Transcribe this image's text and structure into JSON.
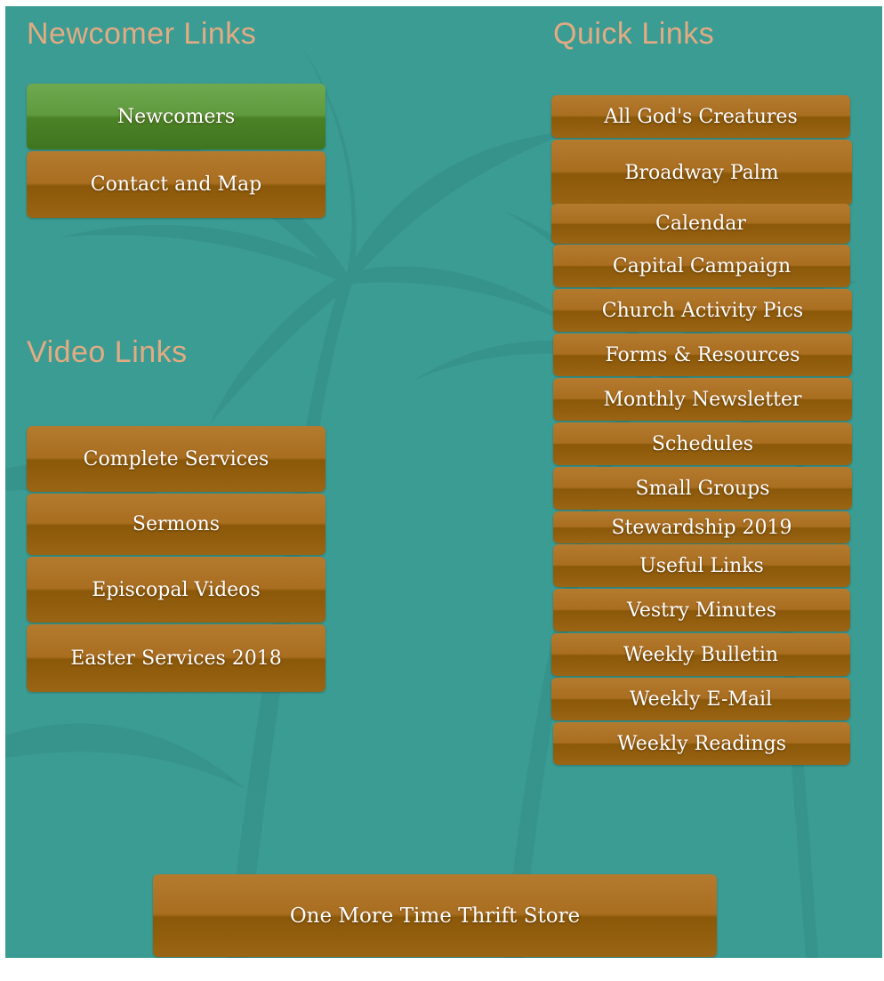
{
  "colors": {
    "background": "#3b9c94",
    "heading": "#e2ab82",
    "button_brown": "#a06a1c",
    "button_green": "#4f8a2c",
    "button_text": "#ffffff"
  },
  "newcomer": {
    "heading": "Newcomer Links",
    "buttons": [
      "Newcomers",
      "Contact and Map"
    ]
  },
  "video": {
    "heading": "Video Links",
    "buttons": [
      "Complete Services",
      "Sermons",
      "Episcopal Videos",
      "Easter Services 2018"
    ]
  },
  "quick": {
    "heading": "Quick Links",
    "buttons": [
      "All God's Creatures",
      "Broadway Palm",
      "Calendar",
      "Capital Campaign",
      "Church Activity Pics",
      "Forms & Resources",
      "Monthly Newsletter",
      "Schedules",
      "Small Groups",
      "Stewardship 2019",
      "Useful Links",
      "Vestry Minutes",
      "Weekly Bulletin",
      "Weekly E-Mail",
      "Weekly Readings"
    ]
  },
  "thrift": {
    "label": "One More Time Thrift Store"
  },
  "background_image": "palm-trees-silhouette"
}
